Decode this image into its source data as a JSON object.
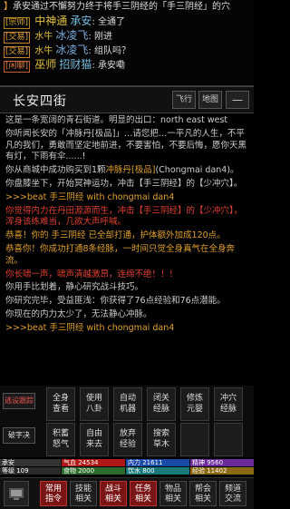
{
  "chat": {
    "line1": {
      "prefix": "】",
      "text": "承安通过不懈努力终于将手三阴经的「手三阴经」的穴"
    },
    "line2": {
      "tag": "[宗师]",
      "rank": "中神通",
      "name": "承安",
      "text": ": 全通了"
    },
    "line3": {
      "tag": "[交易]",
      "rank": "水牛",
      "name": "冰凌飞",
      "text": ": 刚进"
    },
    "line4": {
      "tag": "[交易]",
      "rank": "水牛",
      "name": "冰凌飞",
      "text": ": 组队吗？"
    },
    "line5": {
      "tag": "[闲聊]",
      "rank": "巫师",
      "name": "招财猫",
      "text": ": 承安嘞"
    }
  },
  "location": {
    "title": "长安四街",
    "fly_label": "飞行",
    "map_label": "地图",
    "menu_label": "—"
  },
  "log": {
    "p1": "这是一条宽阔的青石街道。明显的出口：north east west",
    "p2": "你听闻长安的「冲脉丹[极品]」…请您把…一平凡的人生，不平凡的我们，勇敢而坚定地前进，不要害怕，不要后悔，愿你天黑有灯，下雨有伞......!",
    "p3a": "你从商城中成功购买到1颗",
    "p3b": "冲脉丹[极品]",
    "p3c": "(Chongmai dan4)。",
    "p4": "你盘膝坐下，开始冥神运功，冲击【手三阴经】的【少冲穴】。",
    "p5": ">>>beat 手三阴经 with chongmai dan4",
    "p6": "你觉得内力在丹田源源而生，冲击【手三阴经】的【少冲穴】，浑身该练难当，几欲大声呼喊。",
    "p7": "恭喜！你的 手三阴经 已全部打通，护体额外加成120点。",
    "p8": "恭喜你！你成功打通8条经脉，一时间只觉全身真气在全身奔流。",
    "p9": "你长啸一声，啸声清越激昂，连绵不绝！！！",
    "p10": "你用手比划着，静心研究战斗技巧。",
    "p11": "你研究完毕，受益匪浅：你获得了76点经验和76点潜能。",
    "p12": "你现在的内力太少了，无法静心冲脉。",
    "p13": ">>>beat 手三阴经 with chongmai dan4"
  },
  "actions": {
    "side": [
      "逃设跟踪",
      "破字决"
    ],
    "row1": [
      {
        "l1": "全身",
        "l2": "查看"
      },
      {
        "l1": "使用",
        "l2": "八卦"
      },
      {
        "l1": "自动",
        "l2": "机器"
      },
      {
        "l1": "闭关",
        "l2": "经脉"
      },
      {
        "l1": "修炼",
        "l2": "元婴"
      },
      {
        "l1": "冲穴",
        "l2": "经脉"
      }
    ],
    "row2": [
      {
        "l1": "积蓄",
        "l2": "怒气"
      },
      {
        "l1": "自由",
        "l2": "来去"
      },
      {
        "l1": "放弃",
        "l2": "经验"
      },
      {
        "l1": "搜索",
        "l2": "草木"
      },
      {
        "l1": "",
        "l2": ""
      },
      {
        "l1": "",
        "l2": ""
      }
    ]
  },
  "status": {
    "name": "承安",
    "qi": "气血 24534",
    "neili": "内力 21611",
    "jingshen": "精神 9560",
    "level": "等级 109",
    "food": "食物 2000",
    "water": "饮水 800",
    "exp": "经验 11402"
  },
  "nav": [
    {
      "l1": "常用",
      "l2": "指令",
      "hot": true
    },
    {
      "l1": "技能",
      "l2": "相关",
      "hot": false
    },
    {
      "l1": "战斗",
      "l2": "相关",
      "hot": true
    },
    {
      "l1": "任务",
      "l2": "相关",
      "hot": true
    },
    {
      "l1": "物品",
      "l2": "相关",
      "hot": false
    },
    {
      "l1": "帮会",
      "l2": "相关",
      "hot": false
    },
    {
      "l1": "频道",
      "l2": "交流",
      "hot": false
    }
  ],
  "colors": {
    "accent_red": "#7a1515",
    "log_gold": "#e0a030",
    "log_blue": "#5f8fff",
    "log_red": "#e04030"
  }
}
